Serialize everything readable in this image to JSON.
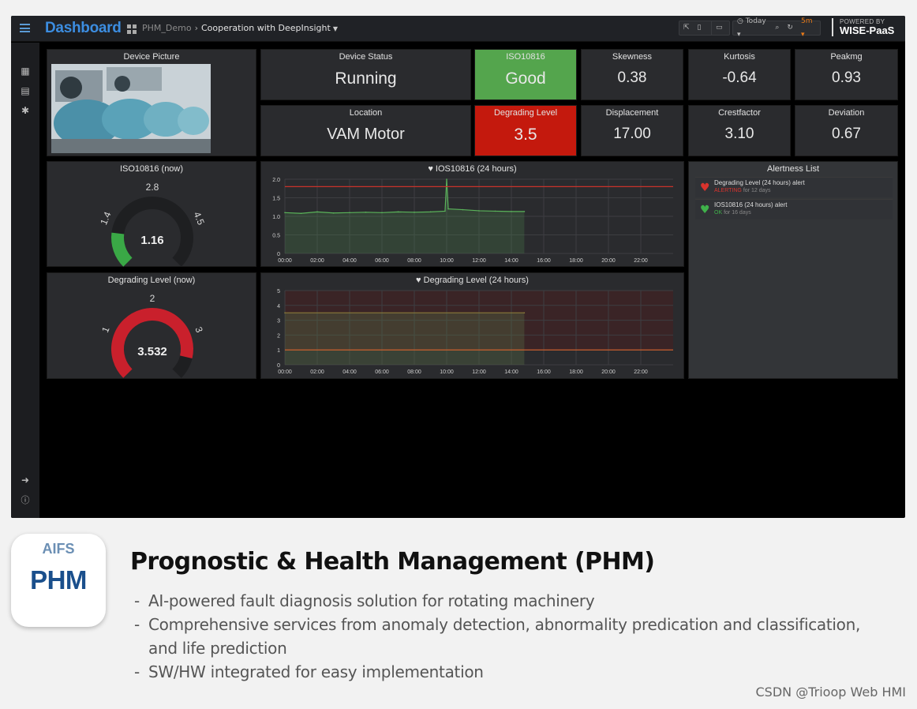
{
  "header": {
    "brand": "Dashboard",
    "breadcrumb_root": "PHM_Demo",
    "breadcrumb_current": "Cooperation with DeepInsight",
    "time_range": "Today",
    "refresh": "5m",
    "powered_by": "POWERED BY",
    "powered_brand": "WISE-PaaS"
  },
  "panels": {
    "device_picture": "Device Picture",
    "device_status": {
      "title": "Device Status",
      "value": "Running"
    },
    "iso_status": {
      "title": "ISO10816",
      "value": "Good"
    },
    "skewness": {
      "title": "Skewness",
      "value": "0.38"
    },
    "kurtosis": {
      "title": "Kurtosis",
      "value": "-0.64"
    },
    "peakmg": {
      "title": "Peakmg",
      "value": "0.93"
    },
    "location": {
      "title": "Location",
      "value": "VAM Motor"
    },
    "degrading_level": {
      "title": "Degrading Level",
      "value": "3.5"
    },
    "displacement": {
      "title": "Displacement",
      "value": "17.00"
    },
    "crestfactor": {
      "title": "Crestfactor",
      "value": "3.10"
    },
    "deviation": {
      "title": "Deviation",
      "value": "0.67"
    }
  },
  "gauges": [
    {
      "title": "ISO10816 (now)",
      "value": "1.16",
      "min": "0",
      "max": "6.0",
      "ticks": [
        "1.4",
        "2.8",
        "4.5"
      ],
      "fill": 0.193,
      "color": "#3aa846"
    },
    {
      "title": "Degrading Level (now)",
      "value": "3.532",
      "min": "0",
      "max": "4",
      "ticks": [
        "1",
        "2",
        "3"
      ],
      "fill": 0.883,
      "color": "#c9202c"
    }
  ],
  "alerts": {
    "title": "Alertness List",
    "items": [
      {
        "name": "Degrading Level (24 hours) alert",
        "state": "ALERTING",
        "since": "for 12 days",
        "color": "#d8332d"
      },
      {
        "name": "IOS10816 (24 hours) alert",
        "state": "OK",
        "since": "for 16 days",
        "color": "#3fb14a"
      }
    ]
  },
  "chart_data": [
    {
      "type": "line",
      "title": "IOS10816 (24 hours)",
      "x_ticks": [
        "00:00",
        "02:00",
        "04:00",
        "06:00",
        "08:00",
        "10:00",
        "12:00",
        "14:00",
        "16:00",
        "18:00",
        "20:00",
        "22:00"
      ],
      "y_ticks": [
        "0",
        "0.5",
        "1.0",
        "1.5",
        "2.0"
      ],
      "ylim": [
        0,
        2.0
      ],
      "xlim": [
        0,
        24
      ],
      "threshold": 1.8,
      "series": [
        {
          "x": [
            0,
            1,
            2,
            3,
            4,
            5,
            6,
            7,
            8,
            9,
            9.9,
            10,
            10.1,
            11,
            12,
            13,
            14,
            14.8
          ],
          "y": [
            1.1,
            1.08,
            1.12,
            1.09,
            1.1,
            1.11,
            1.1,
            1.12,
            1.11,
            1.12,
            1.14,
            2.0,
            1.2,
            1.18,
            1.15,
            1.14,
            1.13,
            1.13
          ]
        }
      ]
    },
    {
      "type": "line",
      "title": "Degrading Level (24 hours)",
      "x_ticks": [
        "00:00",
        "02:00",
        "04:00",
        "06:00",
        "08:00",
        "10:00",
        "12:00",
        "14:00",
        "16:00",
        "18:00",
        "20:00",
        "22:00"
      ],
      "y_ticks": [
        "0",
        "1",
        "2",
        "3",
        "4",
        "5"
      ],
      "ylim": [
        0,
        5
      ],
      "xlim": [
        0,
        24
      ],
      "threshold": 1,
      "series": [
        {
          "x": [
            0,
            14.8
          ],
          "y": [
            3.5,
            3.5
          ]
        }
      ]
    }
  ],
  "description": {
    "app_label_top": "AIFS",
    "app_label_main": "PHM",
    "title": "Prognostic & Health Management (PHM)",
    "bullets": [
      "AI-powered fault diagnosis solution for rotating machinery",
      "Comprehensive services from anomaly detection, abnormality predication and classification, and life prediction",
      "SW/HW integrated for easy implementation"
    ],
    "watermark": "CSDN @Trioop Web HMI"
  }
}
